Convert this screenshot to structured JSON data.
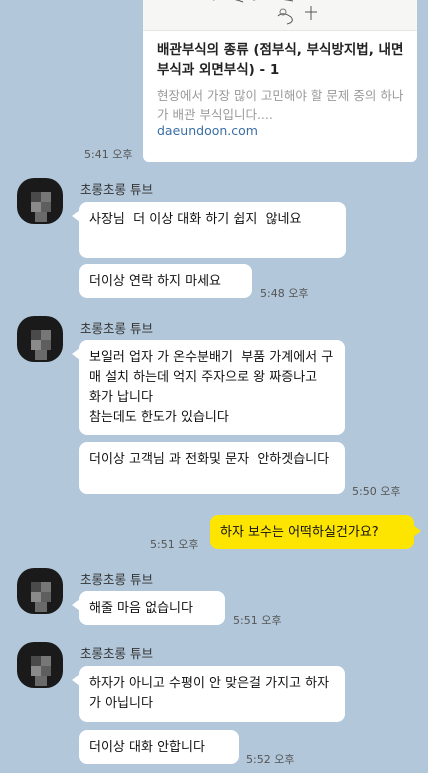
{
  "link_preview": {
    "title": "배관부식의 종류 (점부식, 부식방지법, 내면부식과 외면부식) - 1",
    "description": "현장에서 가장 많이 고민해야 할 문제 중의 하나가 배관 부식입니다....",
    "domain": "daeundoon.com",
    "time": "5:41 오후"
  },
  "messages": [
    {
      "sender": "초롱초롱 튜브",
      "bubbles": [
        "사장님  더 이상 대화 하기 쉽지  않네요",
        "더이상 연락 하지 마세요"
      ],
      "time": "5:48 오후"
    },
    {
      "sender": "초롱초롱 튜브",
      "bubbles": [
        "보일러 업자 가 온수분배기  부품 가계에서 구매 설치 하는데 억지 주자으로 왕 짜증나고  화가 납니다\n참는데도 한도가 있습니다",
        "더이상 고객님 과 전화및 문자  안하겟습니다"
      ],
      "time": "5:50 오후"
    },
    {
      "me": true,
      "text": "하자 보수는 어떡하실건가요?",
      "time": "5:51 오후"
    },
    {
      "sender": "초롱초롱 튜브",
      "bubbles": [
        "해줄 마음 없습니다"
      ],
      "time": "5:51 오후"
    },
    {
      "sender": "초롱초롱 튜브",
      "bubbles": [
        "하자가 아니고 수평이 안 맞은걸 가지고 하자가 아닙니다",
        "더이상 대화 안합니다"
      ],
      "time": "5:52 오후"
    }
  ],
  "colors": {
    "background": "#b2c7da",
    "my_bubble": "#fee500",
    "other_bubble": "#ffffff",
    "link": "#3a6ea5"
  }
}
